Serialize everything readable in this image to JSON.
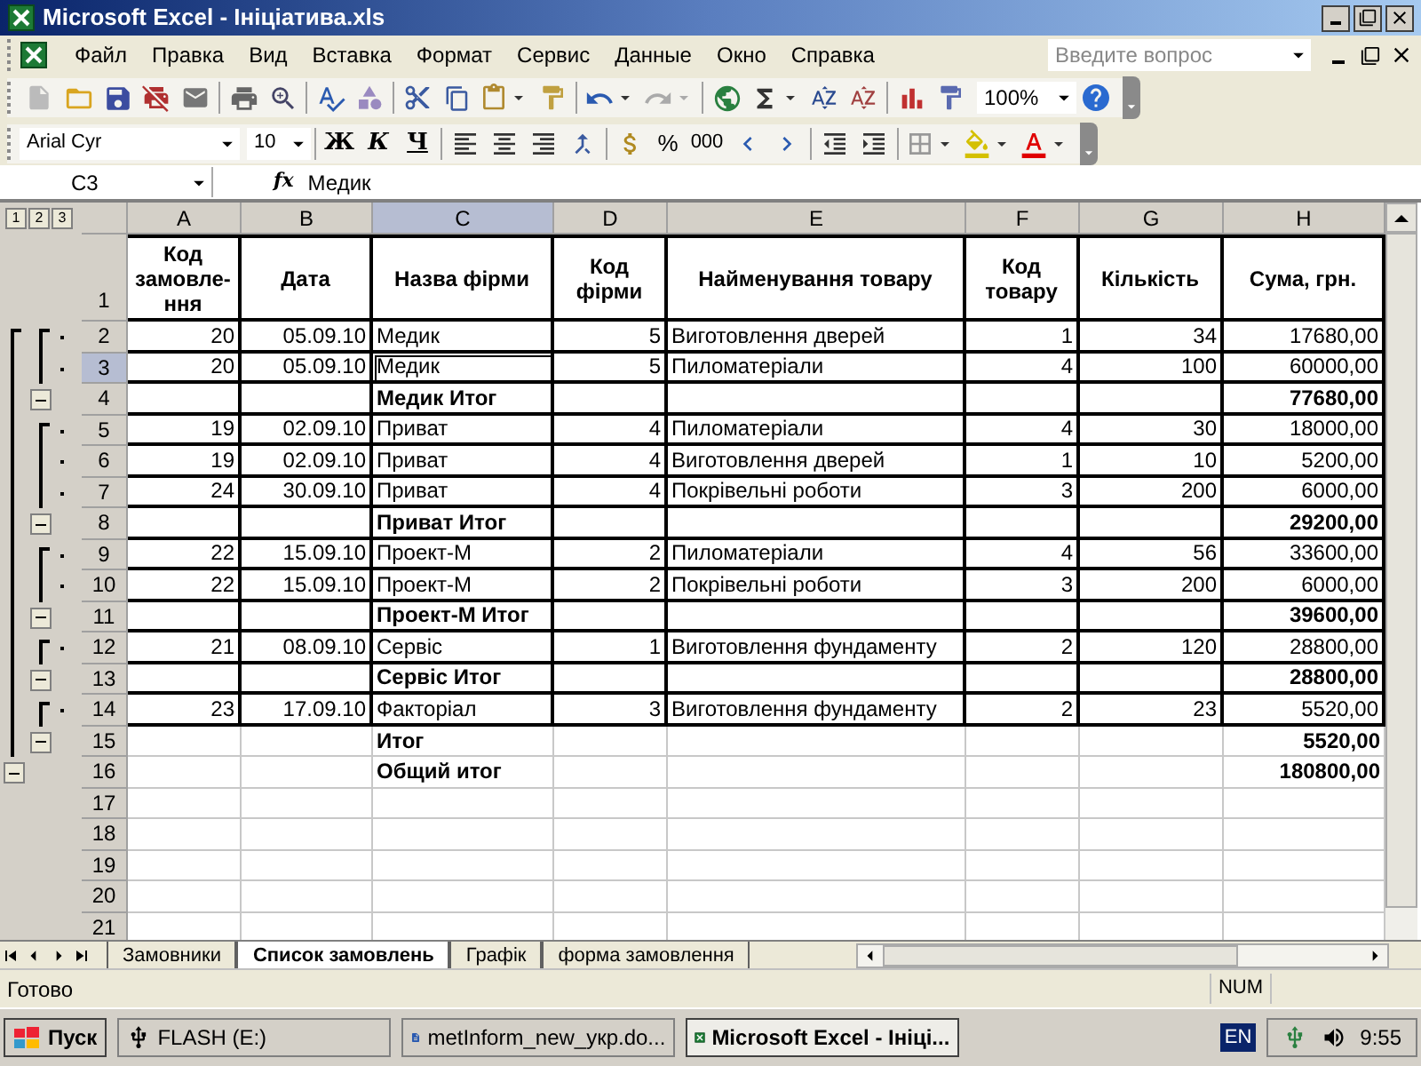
{
  "window": {
    "title": "Microsoft Excel - Ініціатива.xls"
  },
  "menu": [
    "Файл",
    "Правка",
    "Вид",
    "Вставка",
    "Формат",
    "Сервис",
    "Данные",
    "Окно",
    "Справка"
  ],
  "help_search": {
    "placeholder": "Введите вопрос"
  },
  "toolbar": {
    "zoom": "100%",
    "font": "Arial Cyr",
    "size": "10",
    "bold": "Ж",
    "italic": "К",
    "underline": "Ч",
    "percent": "%",
    "thousands": "000"
  },
  "formula_bar": {
    "name_box": "C3",
    "fx": "fx",
    "value": "Медик"
  },
  "outline_levels": [
    "1",
    "2",
    "3"
  ],
  "columns": [
    {
      "letter": "A",
      "selected": false
    },
    {
      "letter": "B",
      "selected": false
    },
    {
      "letter": "C",
      "selected": true
    },
    {
      "letter": "D",
      "selected": false
    },
    {
      "letter": "E",
      "selected": false
    },
    {
      "letter": "F",
      "selected": false
    },
    {
      "letter": "G",
      "selected": false
    },
    {
      "letter": "H",
      "selected": false
    }
  ],
  "rows": [
    {
      "n": "1",
      "kind": "header",
      "bordered": true,
      "selected": false,
      "cells": [
        "Код замовле-ння",
        "Дата",
        "Назва фірми",
        "Код фірми",
        "Найменування товару",
        "Код товару",
        "Кількість",
        "Сума, грн."
      ]
    },
    {
      "n": "2",
      "kind": "detail",
      "bordered": true,
      "selected": false,
      "cells": [
        "20",
        "05.09.10",
        "Медик",
        "5",
        "Виготовлення дверей",
        "1",
        "34",
        "17680,00"
      ]
    },
    {
      "n": "3",
      "kind": "detail",
      "bordered": true,
      "selected": true,
      "cells": [
        "20",
        "05.09.10",
        "Медик",
        "5",
        "Пиломатеріали",
        "4",
        "100",
        "60000,00"
      ]
    },
    {
      "n": "4",
      "kind": "subtotal",
      "bordered": true,
      "selected": false,
      "cells": [
        null,
        null,
        "Медик Итог",
        null,
        null,
        null,
        null,
        "77680,00"
      ]
    },
    {
      "n": "5",
      "kind": "detail",
      "bordered": true,
      "selected": false,
      "cells": [
        "19",
        "02.09.10",
        "Приват",
        "4",
        "Пиломатеріали",
        "4",
        "30",
        "18000,00"
      ]
    },
    {
      "n": "6",
      "kind": "detail",
      "bordered": true,
      "selected": false,
      "cells": [
        "19",
        "02.09.10",
        "Приват",
        "4",
        "Виготовлення дверей",
        "1",
        "10",
        "5200,00"
      ]
    },
    {
      "n": "7",
      "kind": "detail",
      "bordered": true,
      "selected": false,
      "cells": [
        "24",
        "30.09.10",
        "Приват",
        "4",
        "Покрівельні роботи",
        "3",
        "200",
        "6000,00"
      ]
    },
    {
      "n": "8",
      "kind": "subtotal",
      "bordered": true,
      "selected": false,
      "cells": [
        null,
        null,
        "Приват Итог",
        null,
        null,
        null,
        null,
        "29200,00"
      ]
    },
    {
      "n": "9",
      "kind": "detail",
      "bordered": true,
      "selected": false,
      "cells": [
        "22",
        "15.09.10",
        "Проект-М",
        "2",
        "Пиломатеріали",
        "4",
        "56",
        "33600,00"
      ]
    },
    {
      "n": "10",
      "kind": "detail",
      "bordered": true,
      "selected": false,
      "cells": [
        "22",
        "15.09.10",
        "Проект-М",
        "2",
        "Покрівельні роботи",
        "3",
        "200",
        "6000,00"
      ]
    },
    {
      "n": "11",
      "kind": "subtotal",
      "bordered": true,
      "selected": false,
      "cells": [
        null,
        null,
        "Проект-М Итог",
        null,
        null,
        null,
        null,
        "39600,00"
      ]
    },
    {
      "n": "12",
      "kind": "detail",
      "bordered": true,
      "selected": false,
      "cells": [
        "21",
        "08.09.10",
        "Сервіс",
        "1",
        "Виготовлення фундаменту",
        "2",
        "120",
        "28800,00"
      ]
    },
    {
      "n": "13",
      "kind": "subtotal",
      "bordered": true,
      "selected": false,
      "cells": [
        null,
        null,
        "Сервіс Итог",
        null,
        null,
        null,
        null,
        "28800,00"
      ]
    },
    {
      "n": "14",
      "kind": "detail",
      "bordered": true,
      "selected": false,
      "cells": [
        "23",
        "17.09.10",
        "Факторіал",
        "3",
        "Виготовлення фундаменту",
        "2",
        "23",
        "5520,00"
      ]
    },
    {
      "n": "15",
      "kind": "subtotal",
      "bordered": false,
      "selected": false,
      "cells": [
        null,
        null,
        "Итог",
        null,
        null,
        null,
        null,
        "5520,00"
      ]
    },
    {
      "n": "16",
      "kind": "grand",
      "bordered": false,
      "selected": false,
      "cells": [
        null,
        null,
        "Общий итог",
        null,
        null,
        null,
        null,
        "180800,00"
      ]
    },
    {
      "n": "17",
      "kind": "empty",
      "bordered": false,
      "selected": false,
      "cells": []
    },
    {
      "n": "18",
      "kind": "empty",
      "bordered": false,
      "selected": false,
      "cells": []
    },
    {
      "n": "19",
      "kind": "empty",
      "bordered": false,
      "selected": false,
      "cells": []
    },
    {
      "n": "20",
      "kind": "empty",
      "bordered": false,
      "selected": false,
      "cells": []
    },
    {
      "n": "21",
      "kind": "empty",
      "bordered": false,
      "selected": false,
      "cells": []
    }
  ],
  "sheet_tabs": [
    {
      "label": "Замовники",
      "selected": false
    },
    {
      "label": "Список замовлень",
      "selected": true
    },
    {
      "label": "Графік",
      "selected": false
    },
    {
      "label": "форма замовлення",
      "selected": false
    }
  ],
  "status_bar": {
    "text": "Готово",
    "num": "NUM"
  },
  "taskbar": {
    "start": "Пуск",
    "tasks": [
      {
        "label": "FLASH (E:)",
        "kind": "drive",
        "selected": false
      },
      {
        "label": "metInform_new_укр.do...",
        "kind": "word",
        "selected": false
      },
      {
        "label": "Microsoft Excel - Ініці...",
        "kind": "excel",
        "selected": true
      }
    ],
    "language": "EN",
    "clock": "9:55"
  }
}
